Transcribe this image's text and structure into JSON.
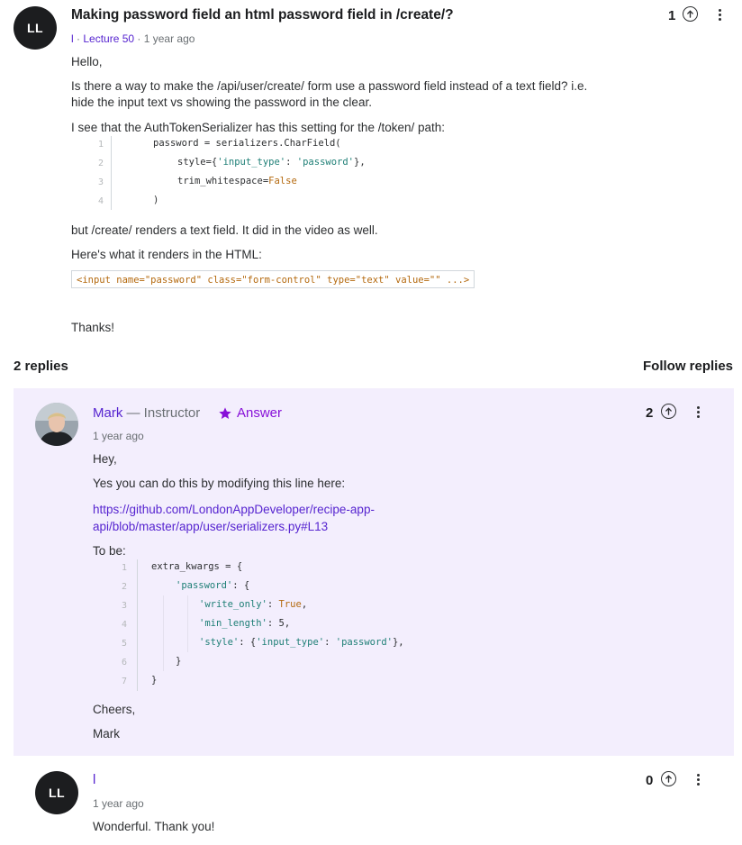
{
  "question": {
    "avatar_initials": "LL",
    "title": "Making password field an html password field in /create/?",
    "author": "l",
    "lecture": "Lecture 50",
    "age": "1 year ago",
    "votes": "1",
    "body": {
      "greeting": "Hello,",
      "para1_line1": "Is there a way to make the /api/user/create/ form use a password field instead of a text field? i.e.",
      "para1_line2": "hide the input text vs showing the password in the clear.",
      "para2": "I see that the AuthTokenSerializer has this setting for the /token/ path:",
      "code_line_numbers": [
        "1",
        "2",
        "3",
        "4"
      ],
      "code": {
        "l1": "password = serializers.CharField(",
        "l2_a": "style={",
        "l2_s1": "'input_type'",
        "l2_b": ": ",
        "l2_s2": "'password'",
        "l2_c": "},",
        "l3_a": "trim_whitespace=",
        "l3_kw": "False",
        "l4": ")"
      },
      "para3": "but /create/ renders a text field. It did in the video as well.",
      "para4": "Here's what it renders in the HTML:",
      "inline_code": "<input name=\"password\" class=\"form-control\" type=\"text\" value=\"\" ...>",
      "closing": "Thanks!"
    }
  },
  "replies_header": {
    "count": "2 replies",
    "follow": "Follow replies"
  },
  "reply1": {
    "name": "Mark",
    "role": " — Instructor",
    "badge": "Answer",
    "age": "1 year ago",
    "votes": "2",
    "greeting": "Hey,",
    "intro": "Yes you can do this by modifying this line here:",
    "link_line1": "https://github.com/LondonAppDeveloper/recipe-app-",
    "link_line2": "api/blob/master/app/user/serializers.py#L13",
    "to_be": "To be:",
    "code_line_numbers": [
      "1",
      "2",
      "3",
      "4",
      "5",
      "6",
      "7"
    ],
    "code": {
      "l1": "extra_kwargs = {",
      "l2_s": "'password'",
      "l2_b": ": {",
      "l3_s": "'write_only'",
      "l3_b": ": ",
      "l3_kw": "True",
      "l3_c": ",",
      "l4_s": "'min_length'",
      "l4_b": ": 5,",
      "l5_s1": "'style'",
      "l5_b": ": {",
      "l5_s2": "'input_type'",
      "l5_c": ": ",
      "l5_s3": "'password'",
      "l5_d": "},",
      "l6": "}",
      "l7": "}"
    },
    "cheers": "Cheers,",
    "signoff": "Mark"
  },
  "reply2": {
    "avatar_initials": "LL",
    "name": "l",
    "age": "1 year ago",
    "votes": "0",
    "text": "Wonderful. Thank you!"
  },
  "colors": {
    "accent": "#5624d0",
    "answer": "#8710d8",
    "reply_bg": "#f3eefd",
    "code_string": "#1e7f76",
    "code_keyword": "#b4690e"
  },
  "icons": {
    "upvote": "arrow-up-circle-icon",
    "more": "vertical-dots-icon",
    "star": "star-icon"
  }
}
